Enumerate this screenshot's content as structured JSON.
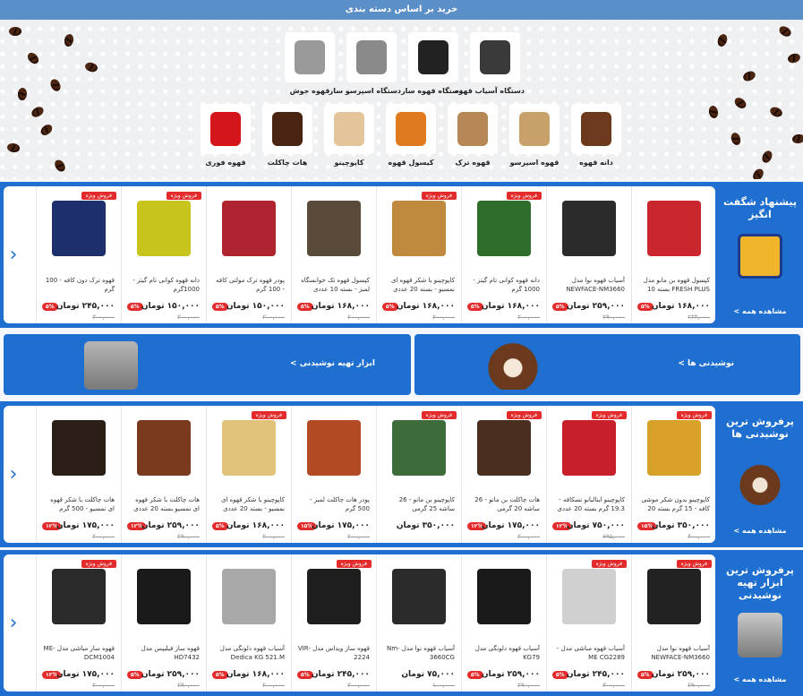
{
  "banner": {
    "title": "خرید بر اساس دسته بندی",
    "row1": [
      {
        "label": "دستگاه آسیاب قهوه",
        "icon": "coffee-grinder-icon",
        "color": "#3a3a3a"
      },
      {
        "label": "دستگاه قهوه ساز",
        "icon": "coffee-maker-icon",
        "color": "#222222"
      },
      {
        "label": "دستگاه اسپرسو ساز",
        "icon": "espresso-machine-icon",
        "color": "#8a8a8a"
      },
      {
        "label": "قهوه جوش",
        "icon": "moka-pot-icon",
        "color": "#9a9a9a"
      }
    ],
    "row2": [
      {
        "label": "دانه قهوه",
        "icon": "coffee-beans-icon",
        "color": "#6b3a1c"
      },
      {
        "label": "قهوه اسپرسو",
        "icon": "espresso-cup-icon",
        "color": "#c8a06a"
      },
      {
        "label": "قهوه ترک",
        "icon": "turkish-coffee-icon",
        "color": "#b58855"
      },
      {
        "label": "کپسول قهوه",
        "icon": "coffee-capsule-icon",
        "color": "#e07a1e"
      },
      {
        "label": "کاپوچینو",
        "icon": "cappuccino-icon",
        "color": "#e4c49a"
      },
      {
        "label": "هات چاکلت",
        "icon": "hot-chocolate-icon",
        "color": "#4a2412"
      },
      {
        "label": "قهوه فوری",
        "icon": "instant-coffee-icon",
        "color": "#d4161c"
      }
    ]
  },
  "sale_badge": "فروش ویژه",
  "currency": "تومان",
  "view_all": "مشاهده همه >",
  "section1": {
    "title": "پیشنهاد شگفت انگیز",
    "products": [
      {
        "name": "کپسول قهوه بن مانو مدل FRESH PLUS بسته 10 عددی",
        "price": "۱۶۸,۰۰۰",
        "old": "۲۳۳,۰۰۰",
        "off": "۵%",
        "sale": false,
        "color": "#c9262e"
      },
      {
        "name": "آسیاب قهوه نوا مدل NEWFACE-NM3660",
        "price": "۲۵۹,۰۰۰",
        "old": "۲۹۰,۰۰۰",
        "off": "۵%",
        "sale": false,
        "color": "#2b2b2b"
      },
      {
        "name": "دانه قهوه کوانی تام گیتز - 1000 گرم",
        "price": "۱۶۸,۰۰۰",
        "old": "۲۰۰,۰۰۰",
        "off": "۵%",
        "sale": true,
        "color": "#2f6e2a"
      },
      {
        "name": "کاپوچینو با شکر قهوه ای نمسیو - بسته 20 عددی",
        "price": "۱۶۸,۰۰۰",
        "old": "۲۰۰,۰۰۰",
        "off": "۵%",
        "sale": true,
        "color": "#c08a3e"
      },
      {
        "name": "کپسول قهوه تک خوانسگاه لمبز - بسته 10 عددی",
        "price": "۱۶۸,۰۰۰",
        "old": "۲۰۰,۰۰۰",
        "off": "۵%",
        "sale": false,
        "color": "#5a4a3a"
      },
      {
        "name": "پودر قهوه ترک مولتی کافه - 100 گرم",
        "price": "۱۵۰,۰۰۰",
        "old": "۲۰۰,۰۰۰",
        "off": "۵%",
        "sale": false,
        "color": "#b02430"
      },
      {
        "name": "دانه قهوه کوانی تام گیتز - 1000گرم",
        "price": "۱۵۰,۰۰۰",
        "old": "۲۰۰,۰۰۰",
        "off": "۵%",
        "sale": true,
        "color": "#c7c41e"
      },
      {
        "name": "قهوه ترک دون کافه - 100 گرم",
        "price": "۲۴۵,۰۰۰",
        "old": "۳۰۰,۰۰۰",
        "off": "۵%",
        "sale": true,
        "color": "#1e2f6e"
      }
    ]
  },
  "promos": [
    {
      "label": "نوشیدنی ها >",
      "icon": "coffee-heart-icon",
      "color": "#6b3a1c"
    },
    {
      "label": "ابزار تهیه نوشیدنی >",
      "icon": "espresso-machine-icon",
      "color": "#9a9a9a"
    }
  ],
  "section2": {
    "title": "پرفروش ترین نوشیدنی ها",
    "products": [
      {
        "name": "کاپوچینو بدون شکر موشی کافه - 15 گرم بسته 20 عددی",
        "price": "۳۵۰,۰۰۰",
        "old": "۴۰۰,۰۰۰",
        "off": "۱۵%",
        "sale": true,
        "color": "#d8a22a"
      },
      {
        "name": "کاپوچینو ایتالیانو نسکافه - 19.3 گرم بسته 20 عددی",
        "price": "۷۵۰,۰۰۰",
        "old": "۷۹۵,۰۰۰",
        "off": "۱۲%",
        "sale": true,
        "color": "#c8202a"
      },
      {
        "name": "هات چاکلت بن مانو - 26 ساشه 20 گرمی",
        "price": "۱۷۵,۰۰۰",
        "old": "۲۰۰,۰۰۰",
        "off": "۱۲%",
        "sale": true,
        "color": "#4a2e1e"
      },
      {
        "name": "کاپوچینو بن مانو - 26 ساشه 25 گرمی",
        "price": "۳۵۰,۰۰۰",
        "old": "",
        "off": "",
        "sale": true,
        "color": "#3d6b3a"
      },
      {
        "name": "پودر هات چاکلت لمبز - 500 گرم",
        "price": "۱۷۵,۰۰۰",
        "old": "۲۰۰,۰۰۰",
        "off": "۱۵%",
        "sale": false,
        "color": "#b24a24"
      },
      {
        "name": "کاپوچینو با شکر قهوه ای نمسیو - بسته 20 عددی",
        "price": "۱۶۸,۰۰۰",
        "old": "۲۰۰,۰۰۰",
        "off": "۵%",
        "sale": true,
        "color": "#e0c27a"
      },
      {
        "name": "هات چاکلت با شکر قهوه ای نمسیو بسته 20 عددی",
        "price": "۲۵۹,۰۰۰",
        "old": "۲۹۰,۰۰۰",
        "off": "۱۲%",
        "sale": false,
        "color": "#7a3a1e"
      },
      {
        "name": "هات چاکلت با شکر قهوه ای نمسیو - 500 گرم",
        "price": "۱۷۵,۰۰۰",
        "old": "۲۰۰,۰۰۰",
        "off": "۱۲%",
        "sale": false,
        "color": "#2a1e16"
      }
    ]
  },
  "section3": {
    "title": "پرفروش ترین ابزار تهیه نوشیدنی",
    "products": [
      {
        "name": "آسیاب قهوه نوا مدل NEWFACE-NM3660",
        "price": "۲۵۹,۰۰۰",
        "old": "۲۹۰,۰۰۰",
        "off": "۵%",
        "sale": true,
        "color": "#222222"
      },
      {
        "name": "آسیاب قهوه مباشی مدل -ME CG2289",
        "price": "۲۴۵,۰۰۰",
        "old": "۳۰۰,۰۰۰",
        "off": "۵%",
        "sale": true,
        "color": "#d0d0d0"
      },
      {
        "name": "آسیاب قهوه دلونگی مدل KG79",
        "price": "۲۵۹,۰۰۰",
        "old": "۲۹۰,۰۰۰",
        "off": "۵%",
        "sale": false,
        "color": "#1a1a1a"
      },
      {
        "name": "آسیاب قهوه نوا مدل Nm-3660CG",
        "price": "۷۵,۰۰۰",
        "old": "۱۰۰,۰۰۰",
        "off": "",
        "sale": false,
        "color": "#2b2b2b"
      },
      {
        "name": "قهوه ساز ویداس مدل VIR-2224",
        "price": "۲۴۵,۰۰۰",
        "old": "۳۰۰,۰۰۰",
        "off": "۵%",
        "sale": true,
        "color": "#1e1e1e"
      },
      {
        "name": "آسیاب قهوه دلونگی مدل Dedica KG 521.M",
        "price": "۱۶۸,۰۰۰",
        "old": "۲۰۰,۰۰۰",
        "off": "۵%",
        "sale": false,
        "color": "#a8a8a8"
      },
      {
        "name": "قهوه ساز فیلیپس مدل HD7432",
        "price": "۲۵۹,۰۰۰",
        "old": "۲۹۰,۰۰۰",
        "off": "۵%",
        "sale": false,
        "color": "#1a1a1a"
      },
      {
        "name": "قهوه ساز مباشی مدل -ME DCM1004",
        "price": "۱۷۵,۰۰۰",
        "old": "۲۰۰,۰۰۰",
        "off": "۱۲%",
        "sale": true,
        "color": "#2a2a2a"
      }
    ]
  }
}
